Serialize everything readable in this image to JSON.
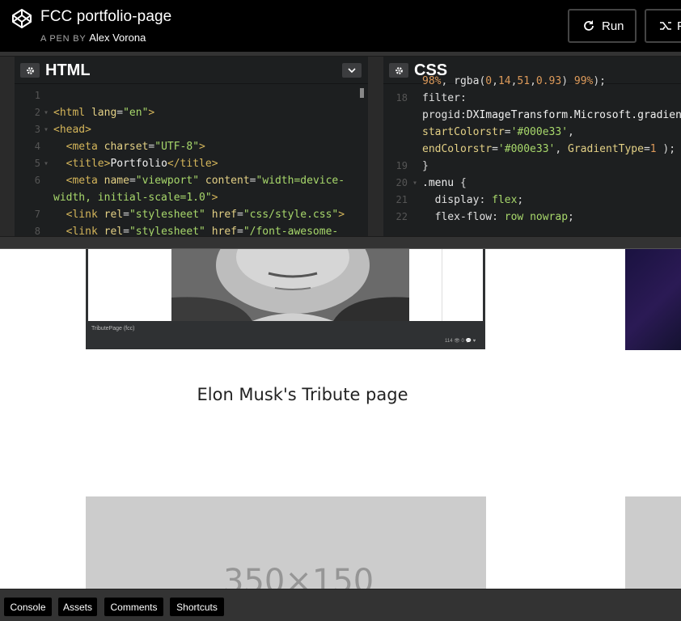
{
  "header": {
    "title": "FCC portfolio-page",
    "byline_prefix": "A PEN BY",
    "author": "Alex Vorona",
    "run_label": "Run",
    "fork_label": "F"
  },
  "html_editor": {
    "title": "HTML",
    "lines": [
      {
        "n": "1",
        "fold": ""
      },
      {
        "n": "2",
        "fold": "▾"
      },
      {
        "n": "3",
        "fold": "▾"
      },
      {
        "n": "4",
        "fold": ""
      },
      {
        "n": "5",
        "fold": "▾"
      },
      {
        "n": "6",
        "fold": ""
      },
      {
        "n": "",
        "fold": ""
      },
      {
        "n": "7",
        "fold": ""
      },
      {
        "n": "8",
        "fold": ""
      }
    ]
  },
  "css_editor": {
    "title": "CSS",
    "lines": [
      {
        "n": "",
        "fold": ""
      },
      {
        "n": "18",
        "fold": ""
      },
      {
        "n": "",
        "fold": ""
      },
      {
        "n": "",
        "fold": ""
      },
      {
        "n": "",
        "fold": ""
      },
      {
        "n": "19",
        "fold": ""
      },
      {
        "n": "20",
        "fold": "▾"
      },
      {
        "n": "21",
        "fold": ""
      },
      {
        "n": "22",
        "fold": ""
      }
    ]
  },
  "preview": {
    "card_label": "TributePage (fcc)",
    "card_stats": "114 👁  0 💬  ♥",
    "tribute_link": "Elon Musk's Tribute page",
    "placeholder_text": "350×150"
  },
  "footer": {
    "console": "Console",
    "assets": "Assets",
    "comments": "Comments",
    "shortcuts": "Shortcuts"
  },
  "colors": {
    "header_bg": "#000000",
    "editor_bg": "#1d1f20",
    "tag": "#d4b55a",
    "string": "#a8d86b",
    "number": "#dd9a5a"
  }
}
